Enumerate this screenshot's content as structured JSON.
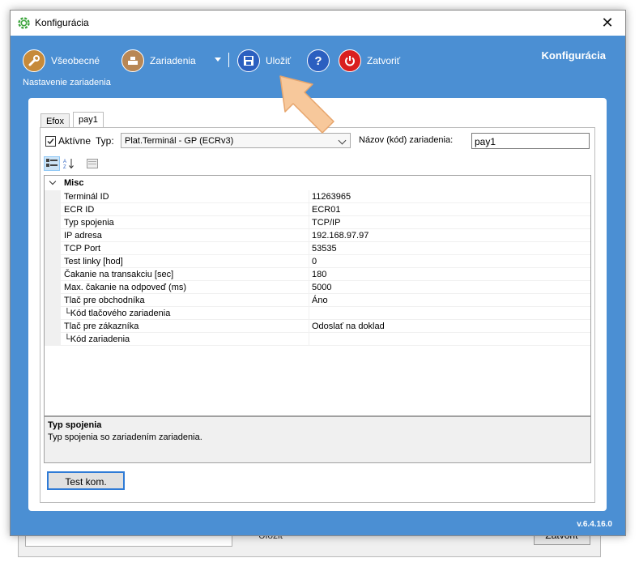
{
  "window": {
    "title": "Konfigurácia",
    "close_glyph": "✕"
  },
  "toolbar": {
    "vseobecne": "Všeobecné",
    "zariadenia": "Zariadenia",
    "ulozit": "Uložiť",
    "help": "?",
    "zatvorit": "Zatvoriť",
    "subtitle": "Nastavenie zariadenia",
    "brand": "Konfigurácia"
  },
  "version": "v.6.4.16.0",
  "tabs": [
    {
      "label": "Efox",
      "active": false
    },
    {
      "label": "pay1",
      "active": true
    }
  ],
  "device": {
    "active_label": "Aktívne",
    "active_checked": true,
    "type_label": "Typ:",
    "type_value": "Plat.Terminál - GP (ECRv3)",
    "name_label": "Názov (kód) zariadenia:",
    "name_value": "pay1"
  },
  "grid": {
    "category": "Misc",
    "rows": [
      {
        "name": "Terminál ID",
        "value": "11263965"
      },
      {
        "name": "ECR ID",
        "value": "ECR01"
      },
      {
        "name": "Typ spojenia",
        "value": "TCP/IP"
      },
      {
        "name": "IP adresa",
        "value": "192.168.97.97"
      },
      {
        "name": "TCP Port",
        "value": "53535"
      },
      {
        "name": "Test linky [hod]",
        "value": "0"
      },
      {
        "name": "Čakanie na transakciu [sec]",
        "value": "180"
      },
      {
        "name": "Max. čakanie na odpoveď (ms)",
        "value": "5000"
      },
      {
        "name": "Tlač pre obchodníka",
        "value": "Áno"
      },
      {
        "name": "└Kód tlačového zariadenia",
        "value": ""
      },
      {
        "name": "Tlač pre zákazníka",
        "value": "Odoslať na doklad"
      },
      {
        "name": "└Kód zariadenia",
        "value": ""
      }
    ]
  },
  "description": {
    "title": "Typ spojenia",
    "text": "Typ spojenia so zariadením zariadenia."
  },
  "test_button": "Test kom.",
  "background_window": {
    "save": "Uložiť",
    "close": "Zatvoriť"
  },
  "colors": {
    "frame": "#4b8fd3",
    "accent": "#2f7bd6",
    "arrow": "#f7c89b"
  }
}
